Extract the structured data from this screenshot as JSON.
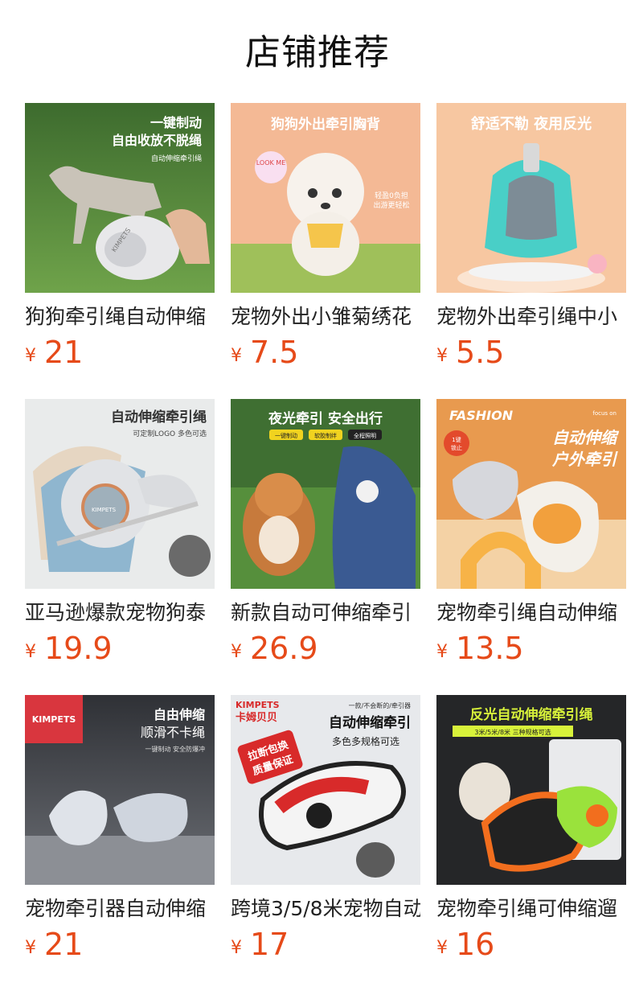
{
  "section": {
    "title": "店铺推荐"
  },
  "currency": "¥",
  "products": [
    {
      "name": "狗狗牵引绳自动伸缩",
      "price": "21",
      "image_text": [
        "一键制动",
        "自由收放不脱绳",
        "自动伸缩牵引绳",
        "KIMPETS"
      ]
    },
    {
      "name": "宠物外出小雏菊绣花",
      "price": "7.5",
      "image_text": [
        "狗狗外出牵引胸背",
        "LOOK ME",
        "轻盈0负担",
        "出游更轻松"
      ]
    },
    {
      "name": "宠物外出牵引绳中小",
      "price": "5.5",
      "image_text": [
        "舒适不勒 夜用反光"
      ]
    },
    {
      "name": "亚马逊爆款宠物狗泰",
      "price": "19.9",
      "image_text": [
        "自动伸缩牵引绳",
        "可定制LOGO 多色可选",
        "KIMPETS"
      ]
    },
    {
      "name": "新款自动可伸缩牵引",
      "price": "26.9",
      "image_text": [
        "夜光牵引 安全出行",
        "一键制动",
        "软胶制绊",
        "全程照明"
      ]
    },
    {
      "name": "宠物牵引绳自动伸缩",
      "price": "13.5",
      "image_text": [
        "FASHION",
        "focus on",
        "自动伸缩",
        "户外牵引",
        "1键",
        "锁止"
      ]
    },
    {
      "name": "宠物牵引器自动伸缩",
      "price": "21",
      "image_text": [
        "KIMPETS",
        "自由伸缩",
        "顺滑不卡绳",
        "一键制动 安全防爆冲"
      ]
    },
    {
      "name": "跨境3/5/8米宠物自动",
      "price": "17",
      "image_text": [
        "KIMPETS",
        "卡姆贝贝",
        "一款/不会断的/牵引器",
        "自动伸缩牵引",
        "多色多规格可选",
        "拉断包换",
        "质量保证"
      ]
    },
    {
      "name": "宠物牵引绳可伸缩遛",
      "price": "16",
      "image_text": [
        "反光自动伸缩牵引绳",
        "3米/5米/8米 三种规格可选"
      ]
    }
  ],
  "colors": {
    "price": "#e64a19",
    "title": "#111111",
    "name": "#222222"
  }
}
